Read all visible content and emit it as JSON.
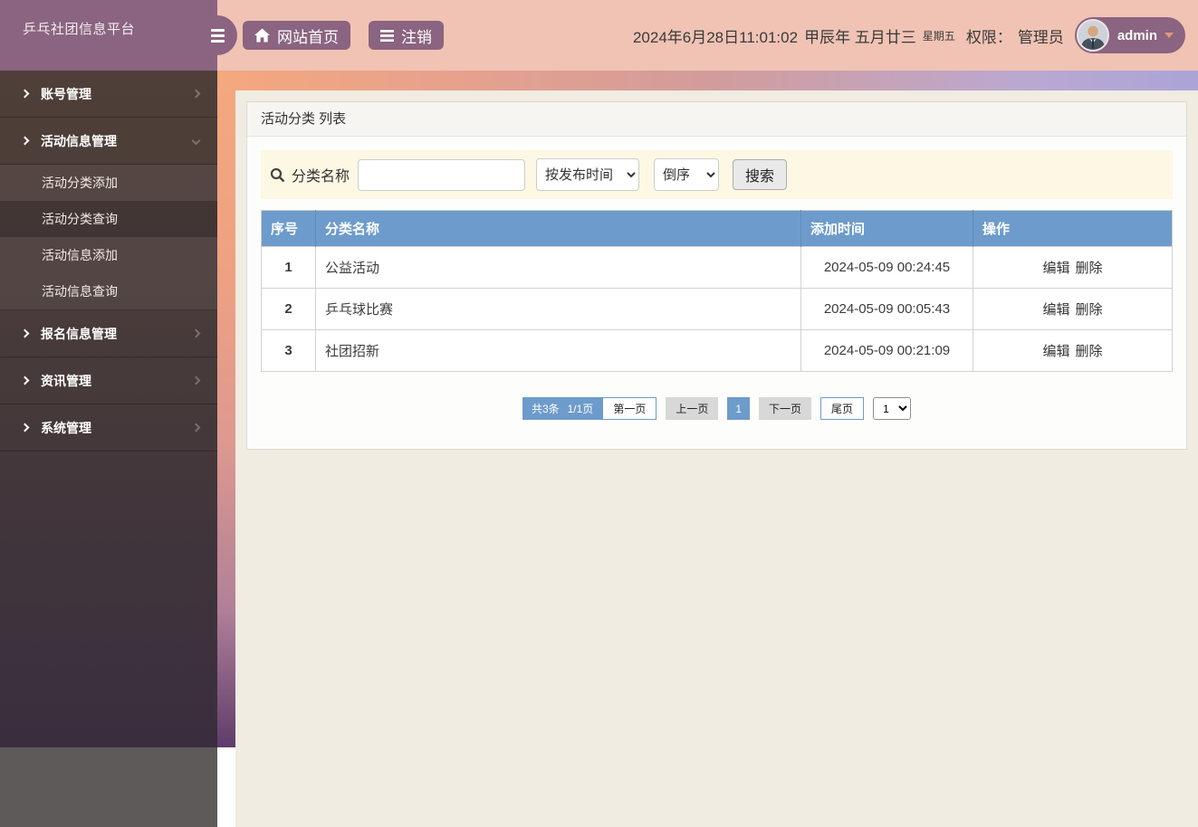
{
  "brand": {
    "title": "乒乓社团信息平台"
  },
  "topbar": {
    "home_button": "网站首页",
    "logout_button": "注销",
    "datetime": "2024年6月28日11:01:02",
    "lunar": "甲辰年 五月廿三",
    "weekday": "星期五",
    "permission_label": "权限：",
    "role": "管理员",
    "username": "admin"
  },
  "sidebar": {
    "items": [
      {
        "label": "账号管理"
      },
      {
        "label": "活动信息管理",
        "children": [
          {
            "label": "活动分类添加"
          },
          {
            "label": "活动分类查询",
            "active": true
          },
          {
            "label": "活动信息添加"
          },
          {
            "label": "活动信息查询"
          }
        ]
      },
      {
        "label": "报名信息管理"
      },
      {
        "label": "资讯管理"
      },
      {
        "label": "系统管理"
      }
    ]
  },
  "panel": {
    "title": "活动分类 列表",
    "search": {
      "label": "分类名称",
      "input_value": "",
      "sort_field": "按发布时间",
      "sort_order": "倒序",
      "button": "搜索"
    },
    "table": {
      "headers": [
        "序号",
        "分类名称",
        "添加时间",
        "操作"
      ],
      "rows": [
        {
          "no": "1",
          "name": "公益活动",
          "time": "2024-05-09 00:24:45",
          "edit": "编辑",
          "delete": "删除"
        },
        {
          "no": "2",
          "name": "乒乓球比赛",
          "time": "2024-05-09 00:05:43",
          "edit": "编辑",
          "delete": "删除"
        },
        {
          "no": "3",
          "name": "社团招新",
          "time": "2024-05-09 00:21:09",
          "edit": "编辑",
          "delete": "删除"
        }
      ]
    },
    "pagination": {
      "total": "共3条",
      "page_info": "1/1页",
      "first": "第一页",
      "prev": "上一页",
      "current": "1",
      "next": "下一页",
      "last": "尾页",
      "page_select": "1"
    }
  },
  "colors": {
    "brand_mauve": "#8a6480",
    "topbar_pink": "#f0c3b4",
    "table_header_blue": "#6d9bcb",
    "search_cream": "#fdf8e3",
    "content_beige": "#f0ece2",
    "sidebar_dark": "#463a3a"
  }
}
